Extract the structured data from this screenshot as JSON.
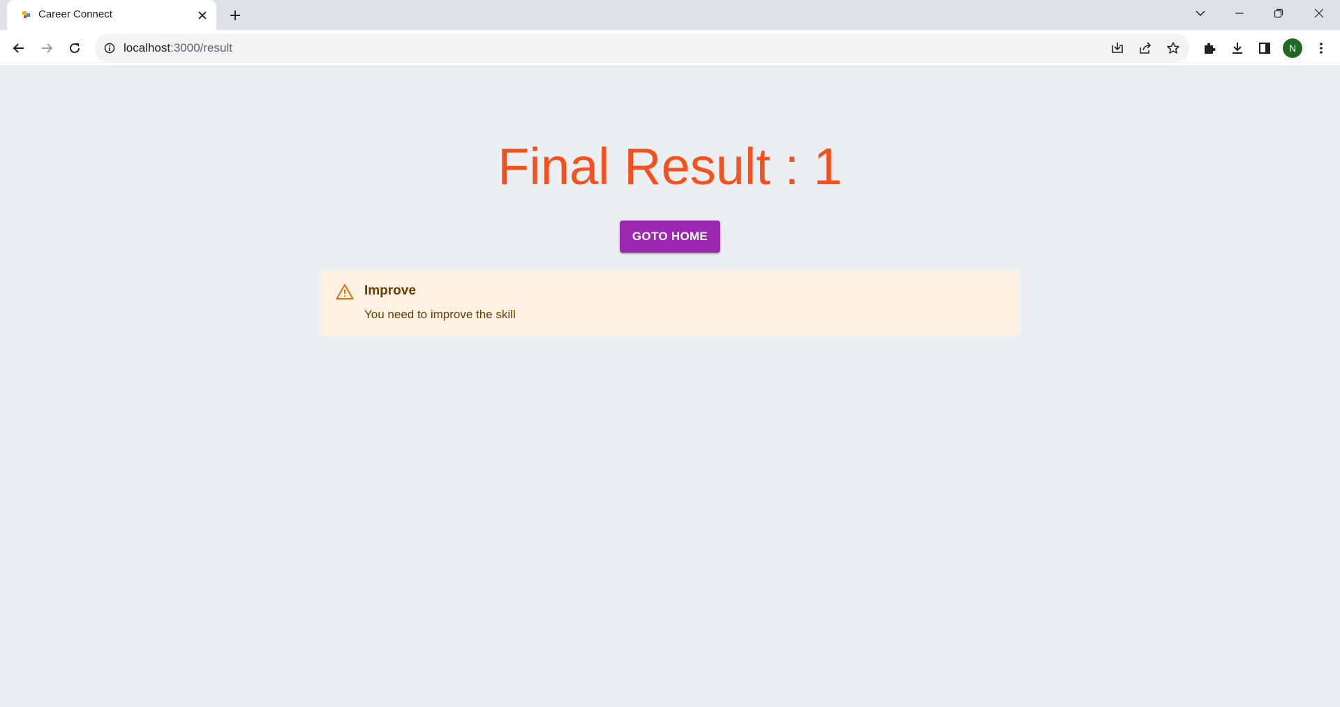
{
  "browser": {
    "tab_title": "Career Connect",
    "url_host": "localhost",
    "url_path": ":3000/result",
    "profile_initial": "N",
    "icons": {
      "favicon": "app-favicon",
      "tab_close": "close-icon",
      "new_tab": "plus-icon",
      "tab_search": "chevron-down-icon",
      "minimize": "minimize-icon",
      "restore": "restore-icon",
      "close_window": "close-icon",
      "back": "arrow-left-icon",
      "forward": "arrow-right-icon",
      "reload": "reload-icon",
      "site_info": "info-icon",
      "install": "install-icon",
      "share": "share-icon",
      "bookmark": "star-icon",
      "extensions": "puzzle-icon",
      "downloads": "download-icon",
      "side_panel": "side-panel-icon",
      "menu": "kebab-menu-icon"
    }
  },
  "page": {
    "result_title": "Final Result : 1",
    "home_button": "GOTO HOME",
    "alert": {
      "severity": "warning",
      "icon": "warning-triangle-icon",
      "title": "Improve",
      "message": "You need to improve the skill"
    },
    "colors": {
      "title": "#f4511e",
      "button": "#9c27b0",
      "alert_bg": "#fff1e3",
      "alert_text": "#663c00",
      "alert_icon": "#ed6c02"
    }
  }
}
